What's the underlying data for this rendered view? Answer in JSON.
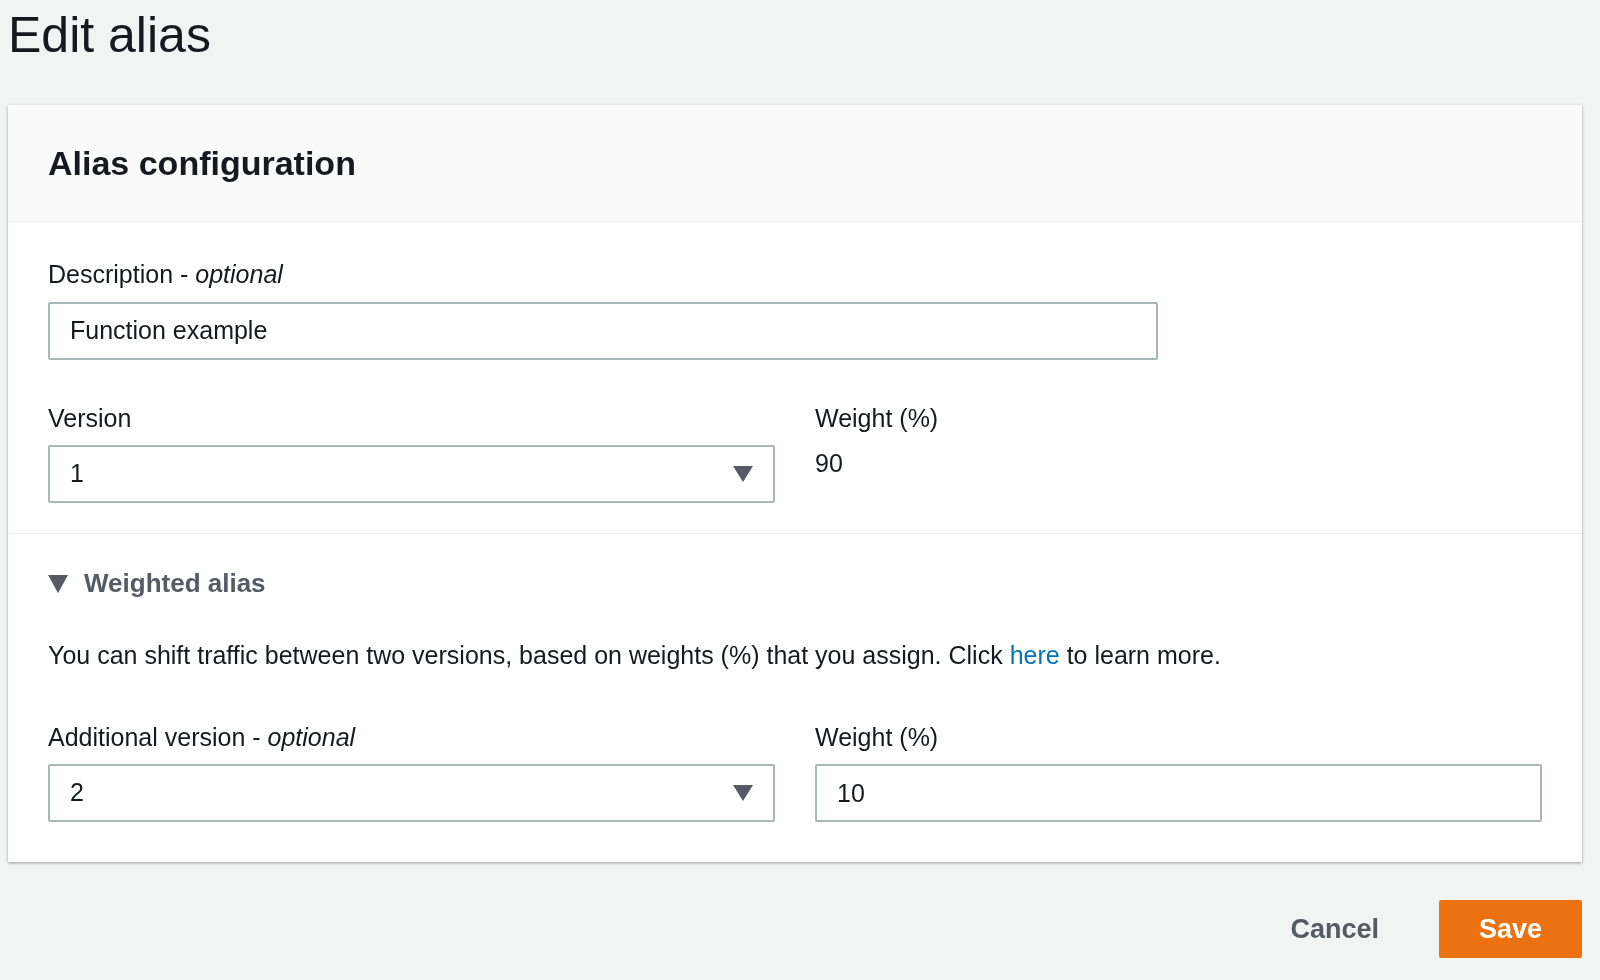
{
  "page": {
    "title": "Edit alias"
  },
  "card": {
    "title": "Alias configuration",
    "description": {
      "label": "Description - *optional*",
      "value": "Function example"
    },
    "version": {
      "label": "Version",
      "value": "1"
    },
    "weight": {
      "label": "Weight (%)",
      "value": "90"
    },
    "weighted_alias": {
      "title": "Weighted alias",
      "expanded": true,
      "text_before": "You can shift traffic between two versions, based on weights (%) that you assign. Click",
      "link": "here",
      "text_after": "to learn more.",
      "additional_version": {
        "label": "Additional version - *optional*",
        "value": "2"
      },
      "additional_weight": {
        "label": "Weight (%)",
        "value": "10"
      }
    }
  },
  "buttons": {
    "cancel": "Cancel",
    "save": "Save"
  }
}
